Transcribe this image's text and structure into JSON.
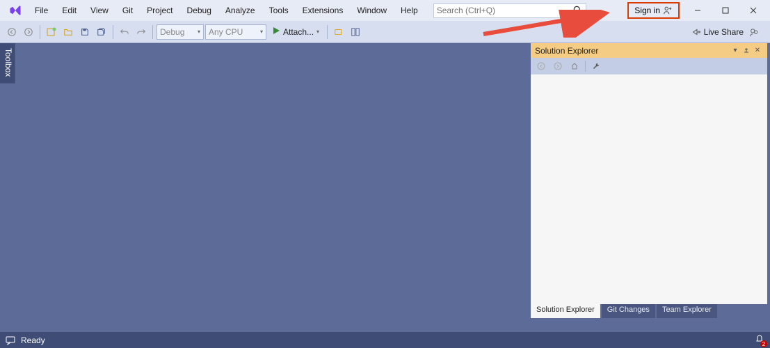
{
  "menu": {
    "items": [
      "File",
      "Edit",
      "View",
      "Git",
      "Project",
      "Debug",
      "Analyze",
      "Tools",
      "Extensions",
      "Window",
      "Help"
    ]
  },
  "search": {
    "placeholder": "Search (Ctrl+Q)"
  },
  "signin": {
    "label": "Sign in"
  },
  "toolbar": {
    "config": "Debug",
    "platform": "Any CPU",
    "attach": "Attach..."
  },
  "liveshare": {
    "label": "Live Share"
  },
  "left_tab": "Toolbox",
  "solution_explorer": {
    "title": "Solution Explorer",
    "tabs": [
      "Solution Explorer",
      "Git Changes",
      "Team Explorer"
    ]
  },
  "status": {
    "ready": "Ready",
    "notif_count": "2"
  }
}
